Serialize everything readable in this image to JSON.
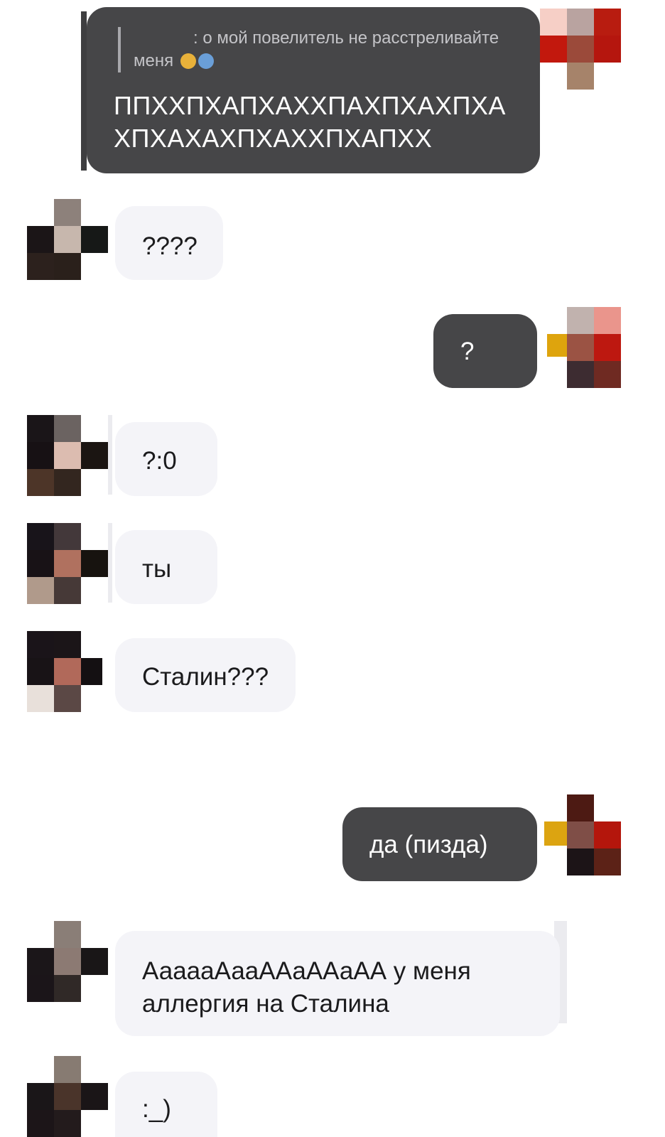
{
  "messages": [
    {
      "side": "out",
      "quote": {
        "prefix": ": о мой повелитель не расстреливайте меня",
        "emojis": [
          "screaming-face-emoji",
          "anxious-face-emoji"
        ]
      },
      "text": "ППХХПХАПХАХХПАХПХАХПХА ХПХАХАХПХАХХПХАПХХ"
    },
    {
      "side": "in",
      "text": "????"
    },
    {
      "side": "out",
      "text": "?"
    },
    {
      "side": "in",
      "text": "?:0"
    },
    {
      "side": "in",
      "text": "ты"
    },
    {
      "side": "in",
      "text": "Сталин???"
    },
    {
      "side": "out",
      "text": "да (пизда)"
    },
    {
      "side": "in",
      "text": "АааааАааААаААаАА у меня аллергия на Сталина"
    },
    {
      "side": "in",
      "text": ":_)"
    }
  ],
  "avatars": {
    "out_1": {
      "icon": "pixelated-avatar-icon"
    },
    "in_1": {
      "icon": "pixelated-avatar-icon"
    },
    "out_2": {
      "icon": "pixelated-avatar-icon"
    },
    "in_2": {
      "icon": "pixelated-avatar-icon"
    },
    "in_3": {
      "icon": "pixelated-avatar-icon"
    },
    "in_4": {
      "icon": "pixelated-avatar-icon"
    },
    "out_3": {
      "icon": "pixelated-avatar-icon"
    },
    "in_5": {
      "icon": "pixelated-avatar-icon"
    },
    "in_6": {
      "icon": "pixelated-avatar-icon"
    }
  },
  "colors": {
    "incoming_bubble": "#f4f4f8",
    "outgoing_bubble": "#464648",
    "incoming_text": "#1b1b1d",
    "outgoing_text": "#ffffff",
    "quote_text": "#c4c4c8"
  }
}
